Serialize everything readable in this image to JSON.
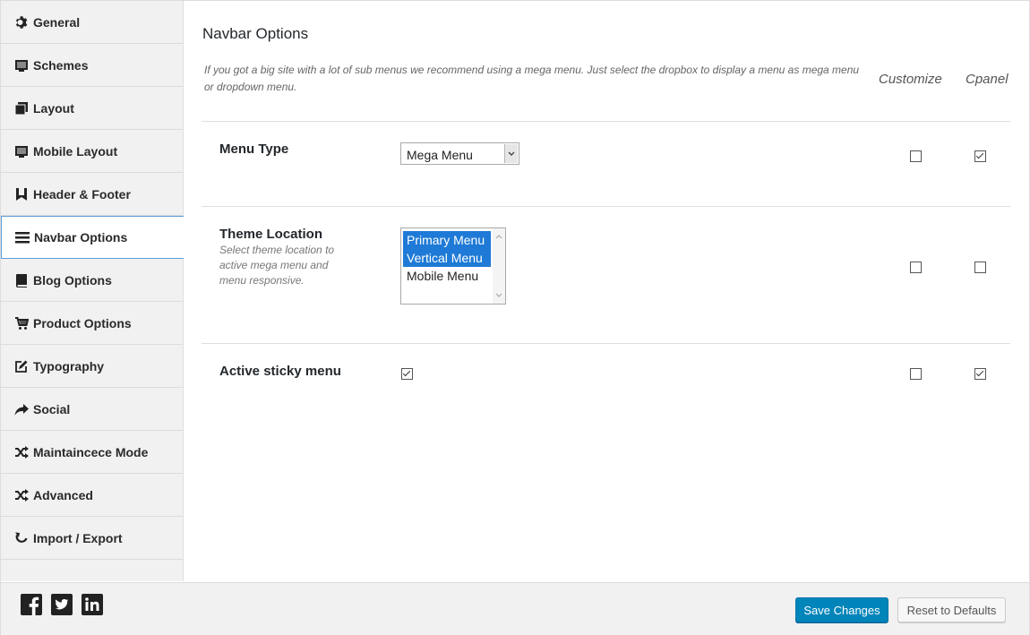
{
  "sidebar": {
    "items": [
      {
        "label": "General",
        "icon": "gear-icon"
      },
      {
        "label": "Schemes",
        "icon": "monitor-icon"
      },
      {
        "label": "Layout",
        "icon": "copy-icon"
      },
      {
        "label": "Mobile Layout",
        "icon": "monitor-icon"
      },
      {
        "label": "Header & Footer",
        "icon": "bookmark-icon"
      },
      {
        "label": "Navbar Options",
        "icon": "menu-icon",
        "active": true
      },
      {
        "label": "Blog Options",
        "icon": "book-icon"
      },
      {
        "label": "Product Options",
        "icon": "cart-icon"
      },
      {
        "label": "Typography",
        "icon": "edit-icon"
      },
      {
        "label": "Social",
        "icon": "share-icon"
      },
      {
        "label": "Maintaincece Mode",
        "icon": "shuffle-icon"
      },
      {
        "label": "Advanced",
        "icon": "shuffle-icon"
      },
      {
        "label": "Import / Export",
        "icon": "refresh-icon"
      }
    ]
  },
  "main": {
    "title": "Navbar Options",
    "intro": "If you got a big site with a lot of sub menus we recommend using a mega menu. Just select the dropbox to display a menu as mega menu or dropdown menu.",
    "columns": {
      "customize": "Customize",
      "cpanel": "Cpanel"
    },
    "rows": {
      "menu_type": {
        "label": "Menu Type",
        "selected": "Mega Menu",
        "customize": false,
        "cpanel": true
      },
      "theme_location": {
        "label": "Theme Location",
        "description": "Select theme location to active mega menu and menu responsive.",
        "options": [
          {
            "label": "Primary Menu",
            "selected": true
          },
          {
            "label": "Vertical Menu",
            "selected": true
          },
          {
            "label": "Mobile Menu",
            "selected": false
          }
        ],
        "customize": false,
        "cpanel": false
      },
      "sticky_menu": {
        "label": "Active sticky menu",
        "checked": true,
        "customize": false,
        "cpanel": true
      }
    }
  },
  "footer": {
    "social": [
      "facebook-icon",
      "twitter-icon",
      "linkedin-icon"
    ],
    "save_label": "Save Changes",
    "reset_label": "Reset to Defaults"
  },
  "colors": {
    "accent": "#0085ba",
    "selection": "#1e7ad6",
    "active_border": "#5b9dd9"
  }
}
